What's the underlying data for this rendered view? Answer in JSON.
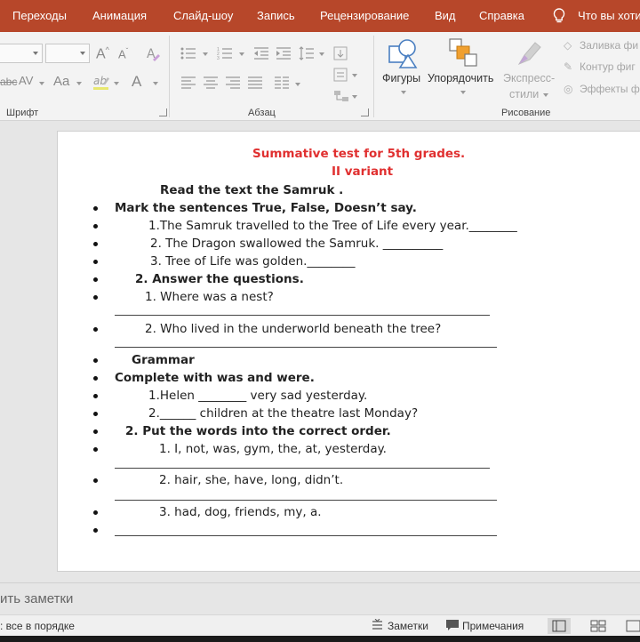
{
  "colors": {
    "ribbon_accent": "#b7472a",
    "title_red": "#e03030"
  },
  "ribbon": {
    "tabs": [
      "Переходы",
      "Анимация",
      "Слайд-шоу",
      "Запись",
      "Рецензирование",
      "Вид",
      "Справка"
    ],
    "tell_me": "Что вы хоти",
    "groups": {
      "font": "Шрифт",
      "paragraph": "Абзац",
      "drawing": "Рисование"
    },
    "buttons": {
      "shapes": "Фигуры",
      "arrange": "Упорядочить",
      "quick_styles_1": "Экспресс-",
      "quick_styles_2": "стили",
      "shape_fill": "Заливка фи",
      "shape_outline": "Контур фиг",
      "shape_effects": "Эффекты ф"
    },
    "icons": [
      "increase-font-icon",
      "decrease-font-icon",
      "clear-formatting-icon",
      "strikethrough-icon",
      "char-spacing-icon",
      "change-case-icon",
      "highlight-icon",
      "font-color-icon",
      "bullets-icon",
      "numbering-icon",
      "decrease-indent-icon",
      "increase-indent-icon",
      "line-spacing-icon",
      "text-direction-icon",
      "align-text-icon",
      "smartart-icon",
      "align-left-icon",
      "center-icon",
      "align-right-icon",
      "justify-icon",
      "columns-icon",
      "shapes-icon",
      "arrange-icon",
      "quick-styles-icon",
      "tell-me-bulb-icon"
    ]
  },
  "slide": {
    "title_line1": "Summative   test  for 5th grades.",
    "title_line2": "II variant",
    "read": "Read the text the Samruk .",
    "mark": "Mark the sentences True, False, Doesn’t  say.",
    "s1": "1.The  Samruk  travelled  to the Tree of Life every year.________",
    "s2": "2.  The  Dragon swallowed the  Samruk. __________",
    "s3": "3. Tree of Life was golden.________",
    "answer": "2.  Answer  the  questions.",
    "q1": "1. Where was a nest?",
    "q2": "2. Who lived in the underworld beneath the tree?",
    "grammar": "Grammar",
    "complete": "Complete with was and were.",
    "g1": "1.Helen ________ very sad yesterday.",
    "g2": "2.______ children at the theatre  last Monday?",
    "put": "2. Put the words into the correct order.",
    "w1": "1. I, not, was, gym, the, at, yesterday.",
    "w2": "2. hair, she, have, long, didn’t.",
    "w3": "3. had, dog, friends, my, a."
  },
  "notes_placeholder": "ить заметки",
  "status": {
    "accessibility": ": все в порядке",
    "notes_btn": "Заметки",
    "comments_btn": "Примечания"
  }
}
